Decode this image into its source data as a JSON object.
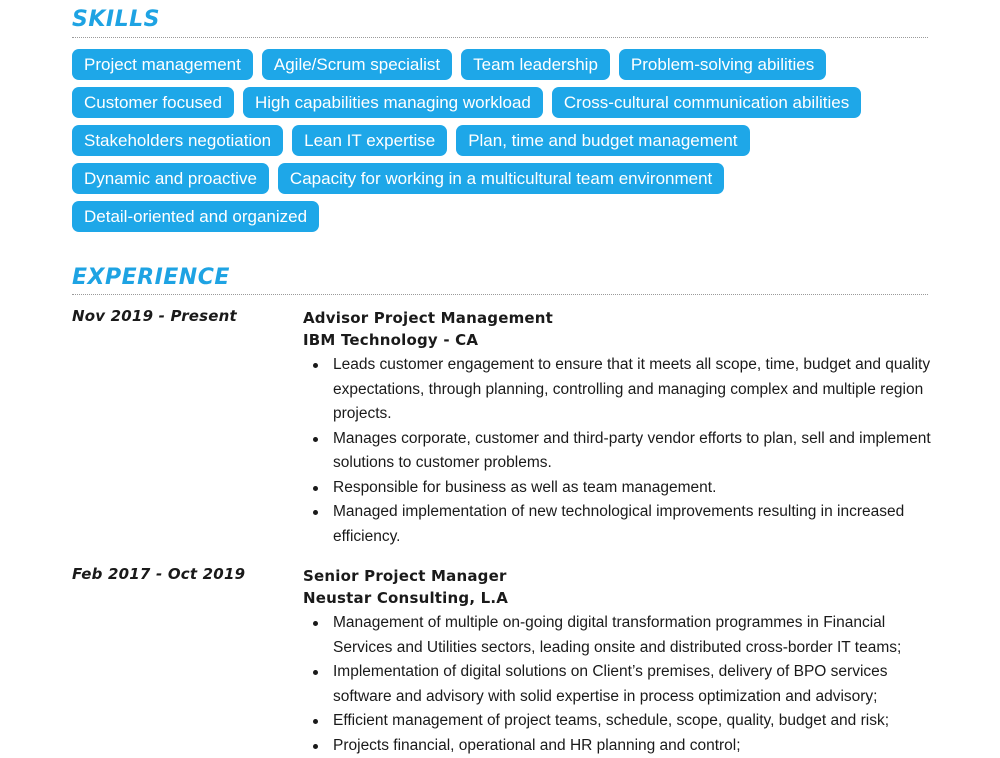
{
  "colors": {
    "accent": "#1ea3e3",
    "chip_bg": "#1ea7e8",
    "chip_text": "#ffffff",
    "text": "#1a1a1a"
  },
  "skills": {
    "title": "SKILLS",
    "items": [
      "Project management",
      "Agile/Scrum specialist",
      "Team leadership",
      "Problem-solving abilities",
      "Customer focused",
      "High capabilities managing workload",
      "Cross-cultural communication abilities",
      "Stakeholders negotiation",
      "Lean IT expertise",
      "Plan, time and budget management",
      "Dynamic and proactive",
      "Capacity for working in a multicultural team environment",
      "Detail-oriented and organized"
    ]
  },
  "experience": {
    "title": "EXPERIENCE",
    "jobs": [
      {
        "date": "Nov 2019 - Present",
        "title": "Advisor Project Management",
        "company": "IBM Technology - CA",
        "bullets": [
          "Leads customer engagement to ensure that it meets all scope, time, budget and quality expectations, through planning, controlling and managing complex and multiple region projects.",
          "Manages corporate, customer and third-party vendor efforts to plan, sell and implement solutions to customer problems.",
          "Responsible for business as well as team management.",
          "Managed implementation of new technological improvements resulting in increased efficiency."
        ]
      },
      {
        "date": "Feb 2017 - Oct 2019",
        "title": "Senior Project Manager",
        "company": "Neustar Consulting, L.A",
        "bullets": [
          "Management of multiple on-going digital transformation programmes in Financial Services and Utilities sectors, leading onsite and distributed cross-border IT teams;",
          "Implementation of digital solutions on Client’s premises, delivery of BPO services software and advisory with solid expertise in process optimization and advisory;",
          "Efficient management of project teams, schedule, scope, quality, budget and risk;",
          "Projects financial, operational and HR planning and control;"
        ]
      }
    ]
  }
}
